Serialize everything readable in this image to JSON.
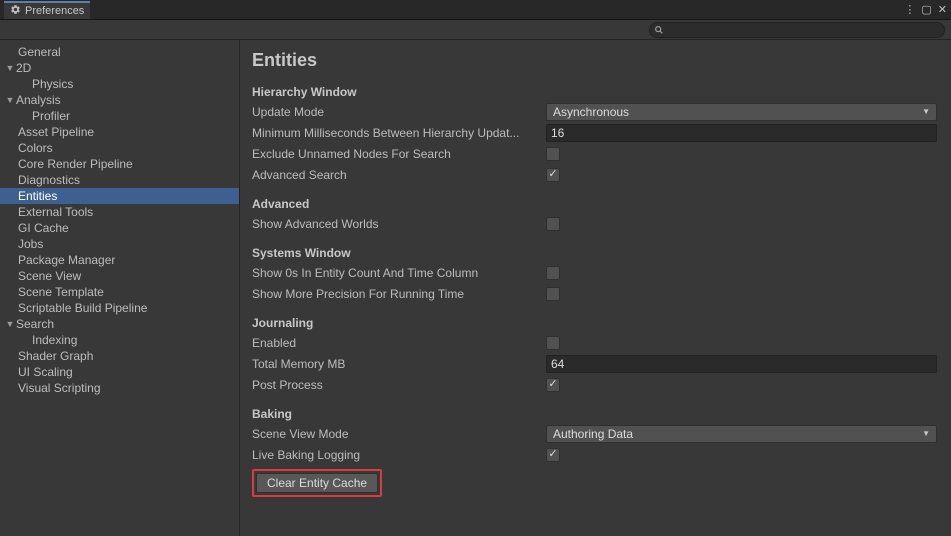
{
  "window": {
    "title": "Preferences"
  },
  "search": {
    "placeholder": ""
  },
  "sidebar": {
    "items": [
      {
        "label": "General",
        "indent": 1,
        "arrow": ""
      },
      {
        "label": "2D",
        "indent": 0,
        "arrow": "▼"
      },
      {
        "label": "Physics",
        "indent": 2,
        "arrow": ""
      },
      {
        "label": "Analysis",
        "indent": 0,
        "arrow": "▼"
      },
      {
        "label": "Profiler",
        "indent": 2,
        "arrow": ""
      },
      {
        "label": "Asset Pipeline",
        "indent": 1,
        "arrow": ""
      },
      {
        "label": "Colors",
        "indent": 1,
        "arrow": ""
      },
      {
        "label": "Core Render Pipeline",
        "indent": 1,
        "arrow": ""
      },
      {
        "label": "Diagnostics",
        "indent": 1,
        "arrow": ""
      },
      {
        "label": "Entities",
        "indent": 1,
        "arrow": "",
        "selected": true
      },
      {
        "label": "External Tools",
        "indent": 1,
        "arrow": ""
      },
      {
        "label": "GI Cache",
        "indent": 1,
        "arrow": ""
      },
      {
        "label": "Jobs",
        "indent": 1,
        "arrow": ""
      },
      {
        "label": "Package Manager",
        "indent": 1,
        "arrow": ""
      },
      {
        "label": "Scene View",
        "indent": 1,
        "arrow": ""
      },
      {
        "label": "Scene Template",
        "indent": 1,
        "arrow": ""
      },
      {
        "label": "Scriptable Build Pipeline",
        "indent": 1,
        "arrow": ""
      },
      {
        "label": "Search",
        "indent": 0,
        "arrow": "▼"
      },
      {
        "label": "Indexing",
        "indent": 2,
        "arrow": ""
      },
      {
        "label": "Shader Graph",
        "indent": 1,
        "arrow": ""
      },
      {
        "label": "UI Scaling",
        "indent": 1,
        "arrow": ""
      },
      {
        "label": "Visual Scripting",
        "indent": 1,
        "arrow": ""
      }
    ]
  },
  "content": {
    "title": "Entities",
    "sections": {
      "hierarchy": {
        "header": "Hierarchy Window",
        "update_mode_label": "Update Mode",
        "update_mode_value": "Asynchronous",
        "min_ms_label": "Minimum Milliseconds Between Hierarchy Updat...",
        "min_ms_value": "16",
        "exclude_unnamed_label": "Exclude Unnamed Nodes For Search",
        "exclude_unnamed_checked": false,
        "advanced_search_label": "Advanced Search",
        "advanced_search_checked": true
      },
      "advanced": {
        "header": "Advanced",
        "show_adv_worlds_label": "Show Advanced Worlds",
        "show_adv_worlds_checked": false
      },
      "systems": {
        "header": "Systems Window",
        "show_0s_label": "Show 0s In Entity Count And Time Column",
        "show_0s_checked": false,
        "show_more_precision_label": "Show More Precision For Running Time",
        "show_more_precision_checked": false
      },
      "journaling": {
        "header": "Journaling",
        "enabled_label": "Enabled",
        "enabled_checked": false,
        "total_mem_label": "Total Memory MB",
        "total_mem_value": "64",
        "post_process_label": "Post Process",
        "post_process_checked": true
      },
      "baking": {
        "header": "Baking",
        "scene_view_mode_label": "Scene View Mode",
        "scene_view_mode_value": "Authoring Data",
        "live_baking_label": "Live Baking Logging",
        "live_baking_checked": true,
        "clear_cache_label": "Clear Entity Cache"
      }
    }
  }
}
